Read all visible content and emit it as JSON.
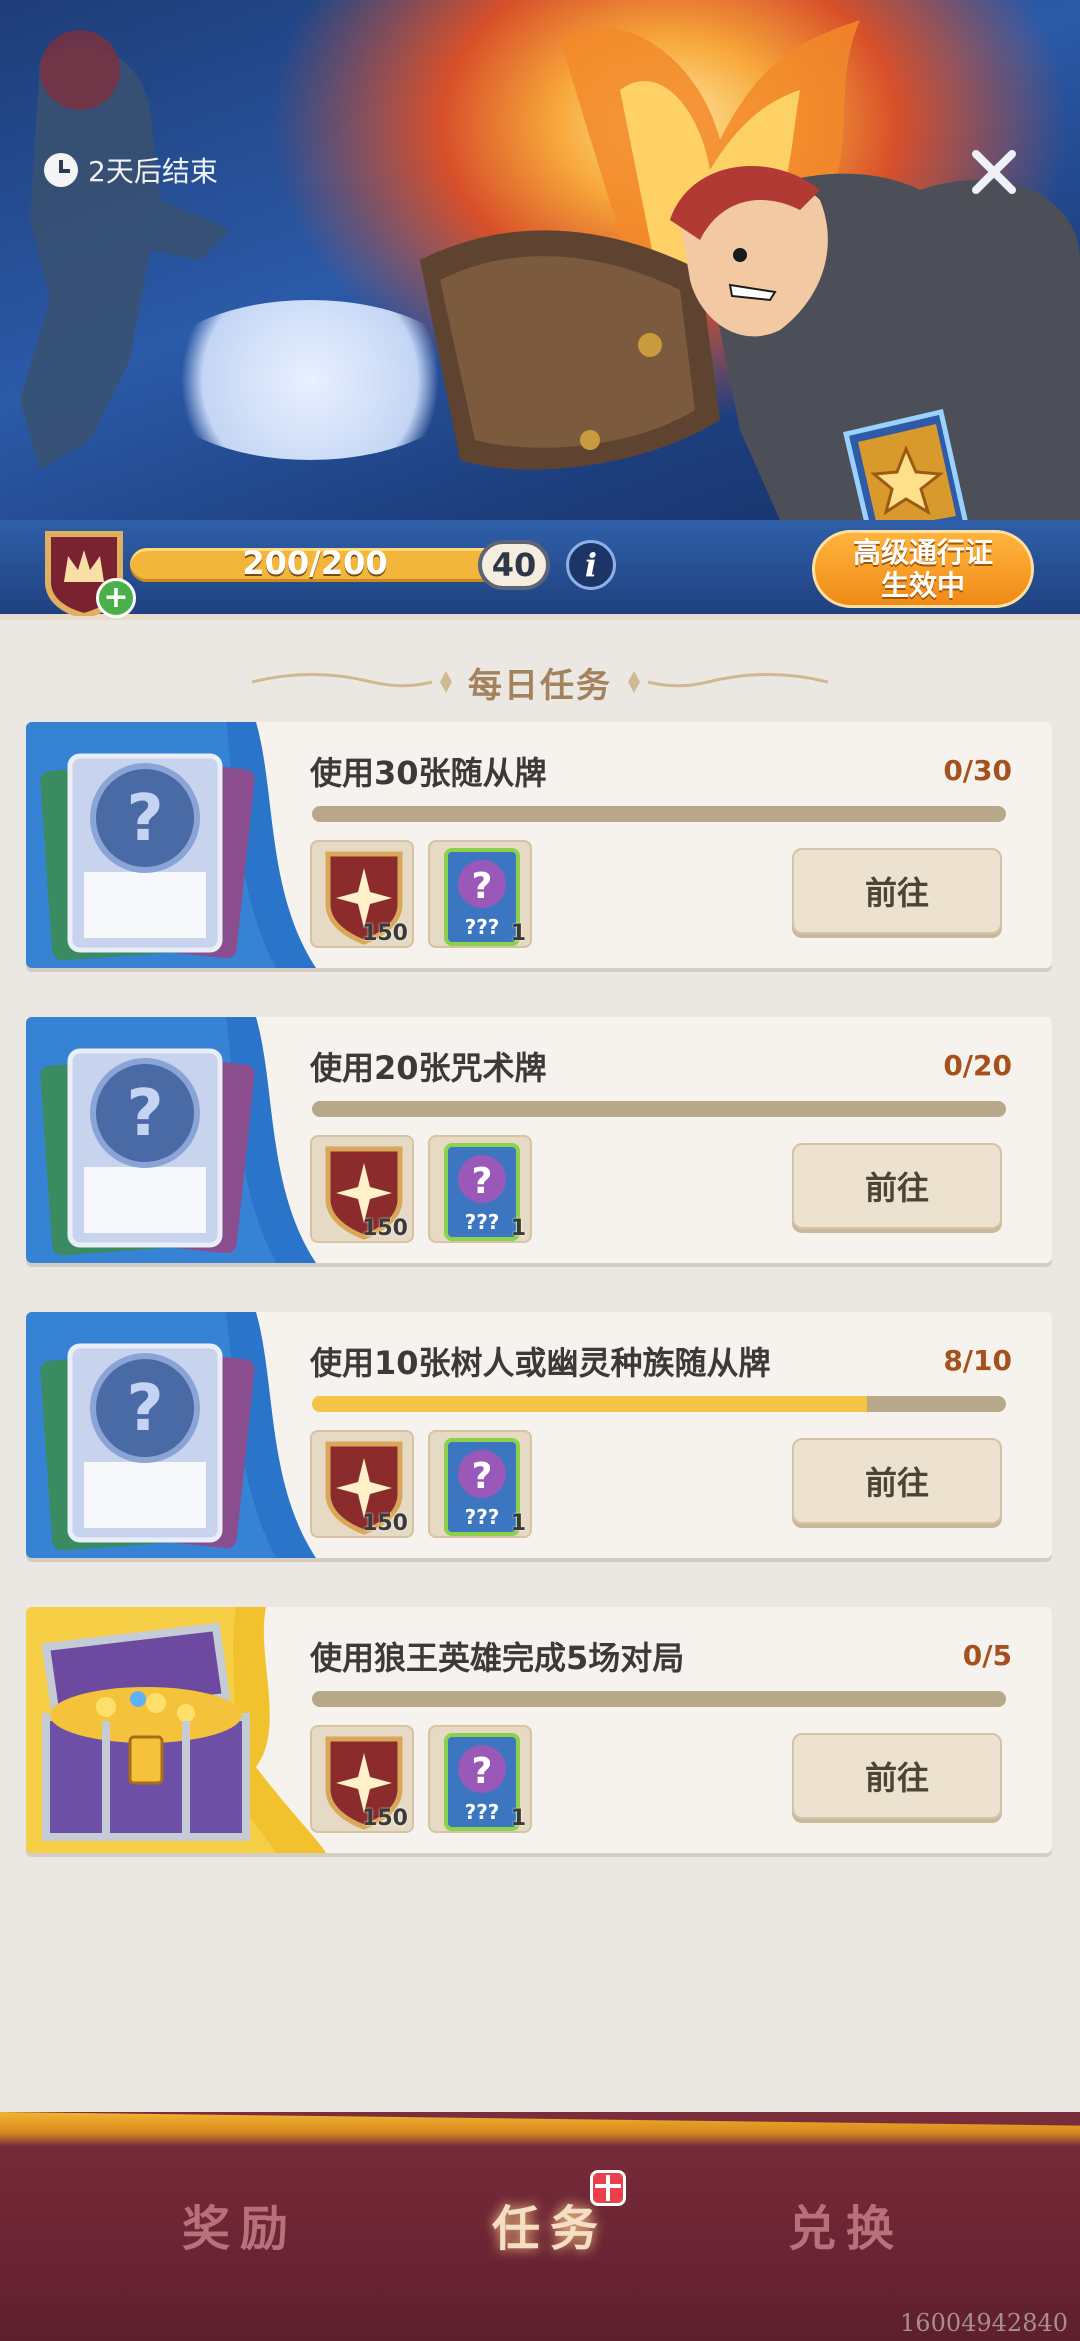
{
  "hero": {
    "timer_text": "2天后结束",
    "xp_text": "200/200",
    "xp_progress": 1.0,
    "level": "40",
    "info_label": "i",
    "pass_status_line1": "高级通行证",
    "pass_status_line2": "生效中"
  },
  "section": {
    "title": "每日任务"
  },
  "tasks": [
    {
      "title": "使用30张随从牌",
      "count": "0/30",
      "progress": 0.0,
      "art": "card-back",
      "rewards": [
        {
          "icon": "shield-star-icon",
          "qty": "150"
        },
        {
          "icon": "mystery-card-icon",
          "qty": "1"
        }
      ],
      "button": "前往"
    },
    {
      "title": "使用20张咒术牌",
      "count": "0/20",
      "progress": 0.0,
      "art": "card-back",
      "rewards": [
        {
          "icon": "shield-star-icon",
          "qty": "150"
        },
        {
          "icon": "mystery-card-icon",
          "qty": "1"
        }
      ],
      "button": "前往"
    },
    {
      "title": "使用10张树人或幽灵种族随从牌",
      "count": "8/10",
      "progress": 0.8,
      "art": "card-back",
      "rewards": [
        {
          "icon": "shield-star-icon",
          "qty": "150"
        },
        {
          "icon": "mystery-card-icon",
          "qty": "1"
        }
      ],
      "button": "前往"
    },
    {
      "title": "使用狼王英雄完成5场对局",
      "count": "0/5",
      "progress": 0.0,
      "art": "treasure-chest",
      "rewards": [
        {
          "icon": "shield-star-icon",
          "qty": "150"
        },
        {
          "icon": "mystery-card-icon",
          "qty": "1"
        }
      ],
      "button": "前往"
    }
  ],
  "nav": {
    "tabs": [
      {
        "label": "奖励",
        "active": false
      },
      {
        "label": "任务",
        "active": true
      },
      {
        "label": "兑换",
        "active": false
      }
    ]
  },
  "watermark": "16004942840",
  "colors": {
    "accent_gold": "#f6c444",
    "count_text": "#a4511e",
    "nav_bg": "#6b2433"
  }
}
